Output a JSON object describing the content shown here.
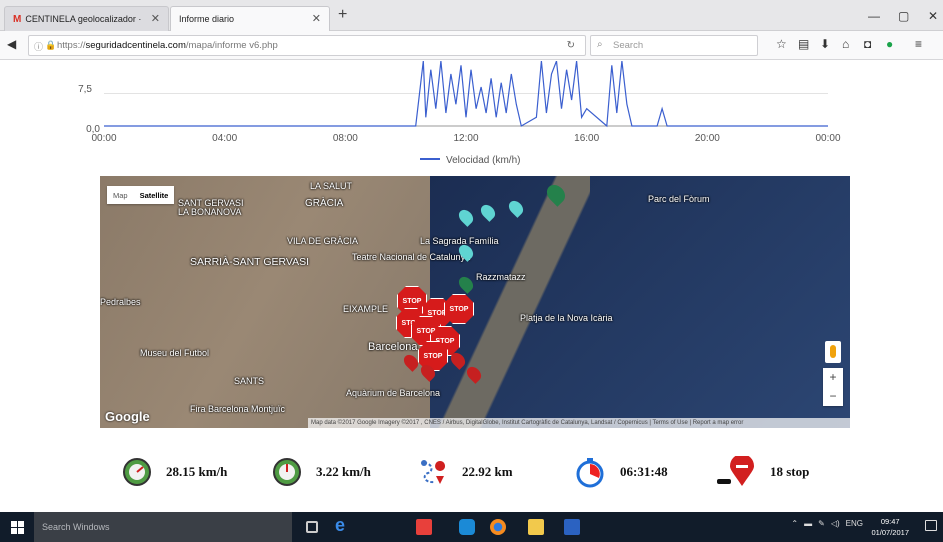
{
  "browser": {
    "tabs": [
      {
        "label": "CENTINELA geolocalizador ·",
        "active": false
      },
      {
        "label": "Informe diario",
        "active": true
      }
    ],
    "url_prefix": "https://",
    "url_domain": "seguridadcentinela.com",
    "url_path": "/mapa/informe v6.php",
    "search_placeholder": "Search",
    "new_tab_label": "+",
    "close_glyph": "✕",
    "window_controls": [
      "—",
      "▢",
      "✕"
    ]
  },
  "chart": {
    "y_ticks": [
      "7,5",
      "0,0"
    ],
    "x_ticks": [
      "00:00",
      "04:00",
      "08:00",
      "12:00",
      "16:00",
      "20:00",
      "00:00"
    ],
    "legend": "Velocidad (km/h)",
    "line_color": "#3b5fcf"
  },
  "chart_data": {
    "type": "line",
    "ylabel": "",
    "xlabel": "",
    "x_range": [
      "00:00",
      "24:00"
    ],
    "ylim": [
      0,
      15
    ],
    "series": [
      {
        "name": "Velocidad (km/h)",
        "x": [
          "00:00",
          "10:20",
          "10:35",
          "10:40",
          "10:50",
          "11:00",
          "11:10",
          "11:20",
          "11:30",
          "11:40",
          "11:50",
          "12:00",
          "12:10",
          "12:20",
          "12:30",
          "12:40",
          "12:50",
          "13:00",
          "13:10",
          "13:20",
          "13:30",
          "13:40",
          "13:50",
          "14:20",
          "14:30",
          "14:40",
          "14:50",
          "15:00",
          "15:10",
          "15:20",
          "15:30",
          "15:40",
          "15:50",
          "16:00",
          "16:40",
          "16:50",
          "17:00",
          "17:10",
          "17:20",
          "17:30",
          "18:20",
          "18:30",
          "18:40",
          "24:00"
        ],
        "values": [
          0,
          0,
          15,
          2,
          13,
          4,
          15,
          3,
          12,
          5,
          14,
          2,
          13,
          4,
          9,
          3,
          11,
          2,
          10,
          3,
          12,
          5,
          0,
          2,
          15,
          3,
          12,
          15,
          4,
          13,
          6,
          15,
          2,
          4,
          0,
          14,
          3,
          15,
          5,
          0,
          0,
          4,
          0,
          0
        ]
      }
    ]
  },
  "map": {
    "toggle": [
      "Map",
      "Satellite"
    ],
    "labels": [
      "SANT GERVASI",
      "LA BONANOVA",
      "GRÀCIA",
      "VILA DE GRÀCIA",
      "SARRIÀ-SANT GERVASI",
      "Pedralbes",
      "Teatre Nacional de Catalunya",
      "La Sagrada Família",
      "Razzmatazz",
      "Parc del Fòrum",
      "Platja de la Nova Icària",
      "EIXAMPLE",
      "Barcelona",
      "Museu del Futbol",
      "Aquàrium de Barcelona",
      "Fira Barcelona Montjuïc",
      "LA SALUT",
      "SANTS"
    ],
    "stop_label": "STOP",
    "zoom_in": "+",
    "zoom_out": "−",
    "google": "Google",
    "attribution": "Map data ©2017 Google Imagery ©2017 , CNES / Airbus, DigitalGlobe, Institut Cartogràfic de Catalunya, Landsat / Copernicus | Terms of Use | Report a map error"
  },
  "stats": [
    {
      "icon": "speedometer-high-icon",
      "value": "28.15 km/h"
    },
    {
      "icon": "speedometer-low-icon",
      "value": "3.22 km/h"
    },
    {
      "icon": "route-icon",
      "value": "22.92 km"
    },
    {
      "icon": "stopwatch-icon",
      "value": "06:31:48"
    },
    {
      "icon": "stop-marker-icon",
      "value": "18 stop"
    }
  ],
  "taskbar": {
    "search_placeholder": "Search Windows",
    "tray_lang": "ENG",
    "time": "09:47",
    "date": "01/07/2017"
  }
}
